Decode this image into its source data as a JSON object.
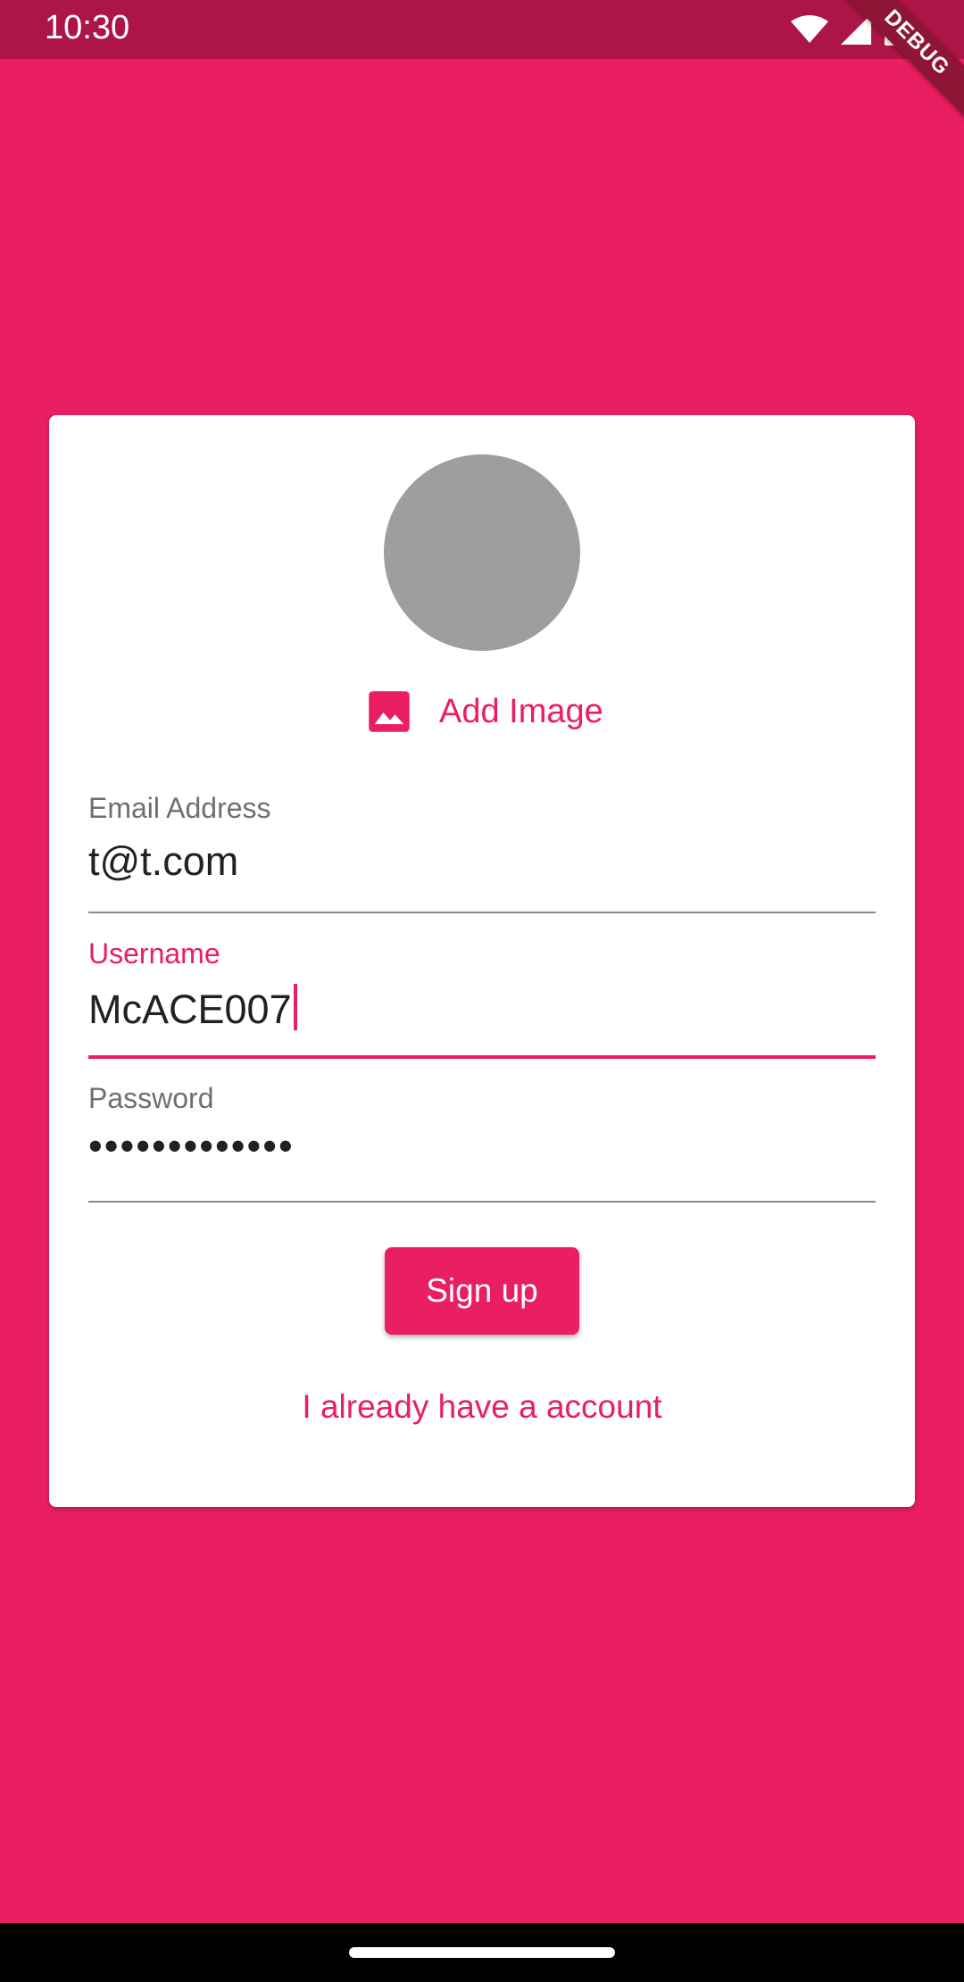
{
  "status_bar": {
    "time": "10:30",
    "icons": [
      "wifi-icon",
      "signal-icon",
      "battery-icon"
    ]
  },
  "debug_banner": {
    "label": "DEBUG"
  },
  "colors": {
    "primary": "#E91E63",
    "status_bar": "#AD1548",
    "avatar": "#9E9E9E",
    "card": "#FFFFFF"
  },
  "card": {
    "add_image": {
      "icon": "image-icon",
      "label": "Add Image"
    },
    "email": {
      "label": "Email Address",
      "value": "t@t.com"
    },
    "username": {
      "label": "Username",
      "value": "McACE007"
    },
    "password": {
      "label": "Password",
      "value": "•••••••••••••"
    },
    "signup_button": "Sign up",
    "account_link": "I already have a account"
  }
}
